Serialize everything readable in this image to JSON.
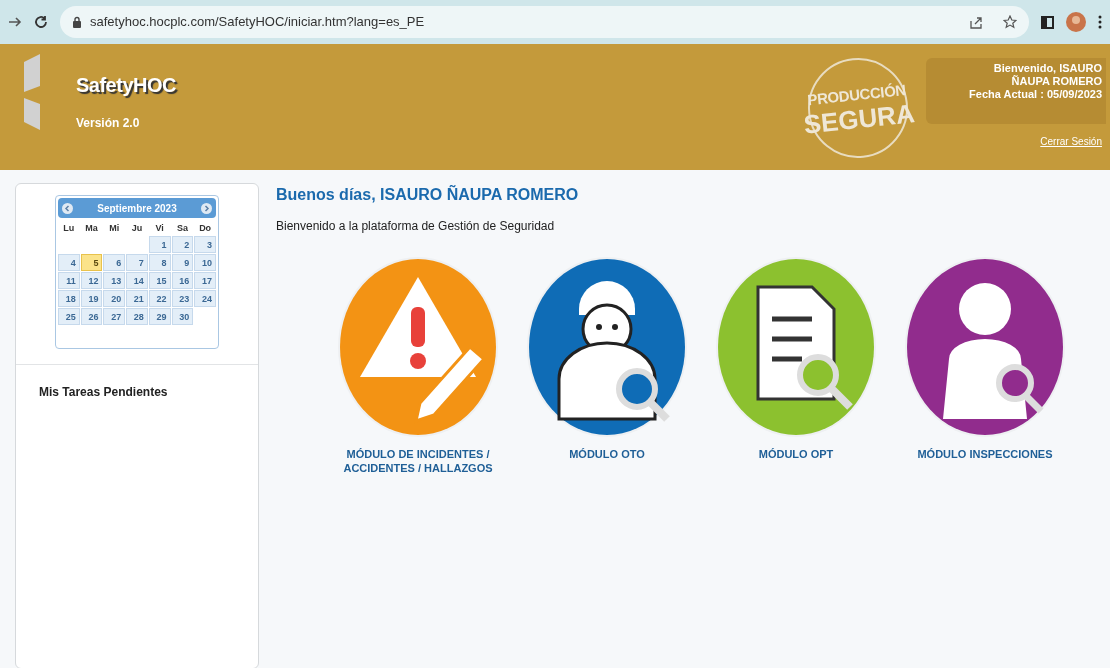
{
  "browser": {
    "url": "safetyhoc.hocplc.com/SafetyHOC/iniciar.htm?lang=es_PE"
  },
  "header": {
    "app_name": "SafetyHOC",
    "version": "Versión 2.0",
    "badge_line_1": "PRODUCCIÓN",
    "badge_line_2": "SEGURA",
    "welcome": "Bienvenido, ISAURO ÑAUPA ROMERO",
    "date": "Fecha Actual : 05/09/2023",
    "logout": "Cerrar Sesión"
  },
  "calendar": {
    "month": "Septiembre 2023",
    "weekdays": [
      "Lu",
      "Ma",
      "Mi",
      "Ju",
      "Vi",
      "Sa",
      "Do"
    ],
    "weeks": [
      [
        {
          "label": "1",
          "selected": false
        },
        {
          "label": "2",
          "selected": false
        },
        {
          "label": "3",
          "selected": false
        }
      ],
      [
        {
          "label": "4",
          "selected": false
        },
        {
          "label": "5",
          "selected": true
        },
        {
          "label": "6",
          "selected": false
        },
        {
          "label": "7",
          "selected": false
        },
        {
          "label": "8",
          "selected": false
        },
        {
          "label": "9",
          "selected": false
        },
        {
          "label": "10",
          "selected": false
        }
      ],
      [
        {
          "label": "11",
          "selected": false
        },
        {
          "label": "12",
          "selected": false
        },
        {
          "label": "13",
          "selected": false
        },
        {
          "label": "14",
          "selected": false
        },
        {
          "label": "15",
          "selected": false
        },
        {
          "label": "16",
          "selected": false
        },
        {
          "label": "17",
          "selected": false
        }
      ],
      [
        {
          "label": "18",
          "selected": false
        },
        {
          "label": "19",
          "selected": false
        },
        {
          "label": "20",
          "selected": false
        },
        {
          "label": "21",
          "selected": false
        },
        {
          "label": "22",
          "selected": false
        },
        {
          "label": "23",
          "selected": false
        },
        {
          "label": "24",
          "selected": false
        }
      ],
      [
        {
          "label": "25",
          "selected": false
        },
        {
          "label": "26",
          "selected": false
        },
        {
          "label": "27",
          "selected": false
        },
        {
          "label": "28",
          "selected": false
        },
        {
          "label": "29",
          "selected": false
        },
        {
          "label": "30",
          "selected": false
        }
      ]
    ]
  },
  "tasks": {
    "title": "Mis Tareas Pendientes"
  },
  "main": {
    "greeting": "Buenos días, ISAURO ÑAUPA ROMERO",
    "subtitle": "Bienvenido a la plataforma de Gestión de Seguridad",
    "modules": [
      {
        "kind": "warning",
        "color": "#f39314",
        "label": "MÓDULO DE INCIDENTES / ACCIDENTES / HALLAZGOS"
      },
      {
        "kind": "worker",
        "color": "#0f6cb6",
        "label": "MÓDULO OTO"
      },
      {
        "kind": "document",
        "color": "#8cc12f",
        "label": "MÓDULO OPT"
      },
      {
        "kind": "person",
        "color": "#912c8d",
        "label": "MÓDULO INSPECCIONES"
      }
    ]
  }
}
